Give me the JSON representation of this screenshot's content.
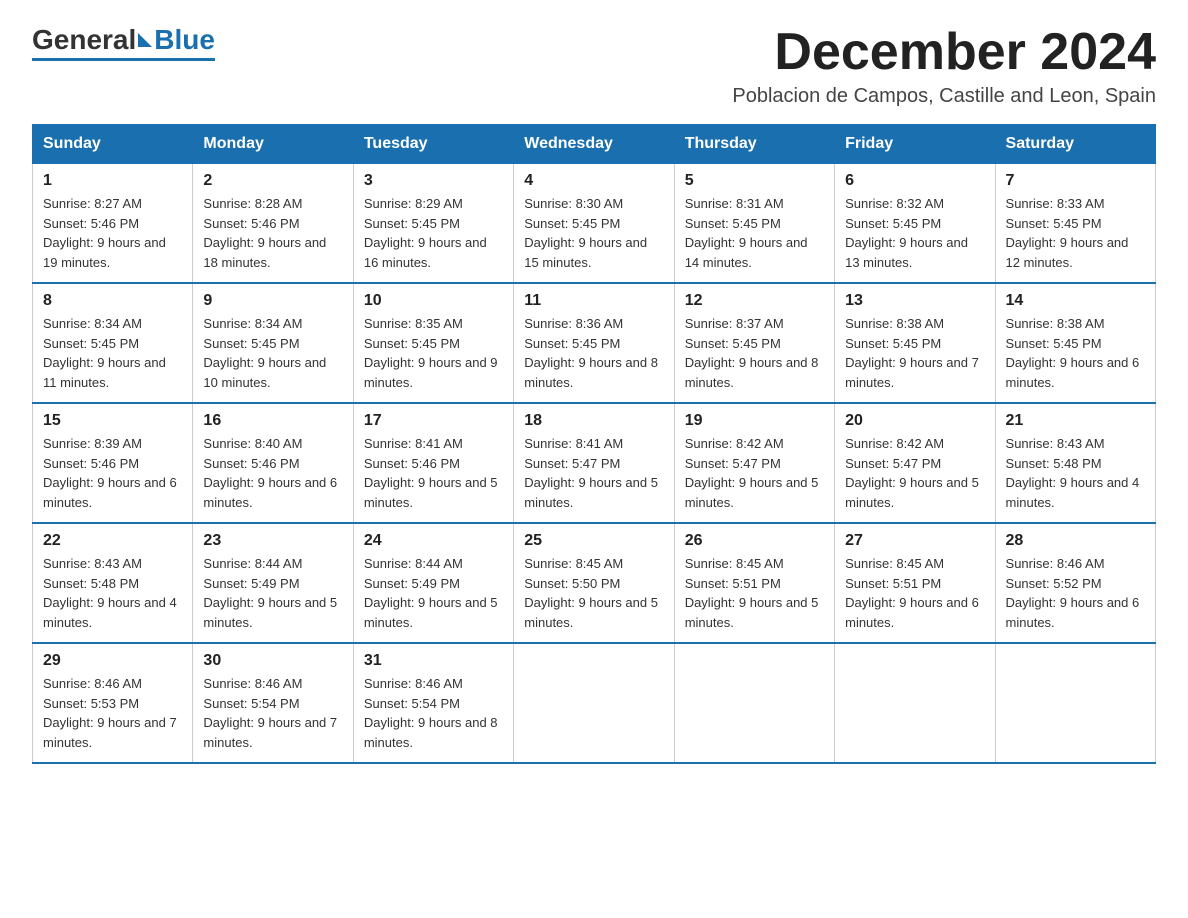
{
  "logo": {
    "general": "General",
    "blue": "Blue"
  },
  "header": {
    "month_title": "December 2024",
    "subtitle": "Poblacion de Campos, Castille and Leon, Spain"
  },
  "days_of_week": [
    "Sunday",
    "Monday",
    "Tuesday",
    "Wednesday",
    "Thursday",
    "Friday",
    "Saturday"
  ],
  "weeks": [
    [
      {
        "day": "1",
        "sunrise": "8:27 AM",
        "sunset": "5:46 PM",
        "daylight": "9 hours and 19 minutes."
      },
      {
        "day": "2",
        "sunrise": "8:28 AM",
        "sunset": "5:46 PM",
        "daylight": "9 hours and 18 minutes."
      },
      {
        "day": "3",
        "sunrise": "8:29 AM",
        "sunset": "5:45 PM",
        "daylight": "9 hours and 16 minutes."
      },
      {
        "day": "4",
        "sunrise": "8:30 AM",
        "sunset": "5:45 PM",
        "daylight": "9 hours and 15 minutes."
      },
      {
        "day": "5",
        "sunrise": "8:31 AM",
        "sunset": "5:45 PM",
        "daylight": "9 hours and 14 minutes."
      },
      {
        "day": "6",
        "sunrise": "8:32 AM",
        "sunset": "5:45 PM",
        "daylight": "9 hours and 13 minutes."
      },
      {
        "day": "7",
        "sunrise": "8:33 AM",
        "sunset": "5:45 PM",
        "daylight": "9 hours and 12 minutes."
      }
    ],
    [
      {
        "day": "8",
        "sunrise": "8:34 AM",
        "sunset": "5:45 PM",
        "daylight": "9 hours and 11 minutes."
      },
      {
        "day": "9",
        "sunrise": "8:34 AM",
        "sunset": "5:45 PM",
        "daylight": "9 hours and 10 minutes."
      },
      {
        "day": "10",
        "sunrise": "8:35 AM",
        "sunset": "5:45 PM",
        "daylight": "9 hours and 9 minutes."
      },
      {
        "day": "11",
        "sunrise": "8:36 AM",
        "sunset": "5:45 PM",
        "daylight": "9 hours and 8 minutes."
      },
      {
        "day": "12",
        "sunrise": "8:37 AM",
        "sunset": "5:45 PM",
        "daylight": "9 hours and 8 minutes."
      },
      {
        "day": "13",
        "sunrise": "8:38 AM",
        "sunset": "5:45 PM",
        "daylight": "9 hours and 7 minutes."
      },
      {
        "day": "14",
        "sunrise": "8:38 AM",
        "sunset": "5:45 PM",
        "daylight": "9 hours and 6 minutes."
      }
    ],
    [
      {
        "day": "15",
        "sunrise": "8:39 AM",
        "sunset": "5:46 PM",
        "daylight": "9 hours and 6 minutes."
      },
      {
        "day": "16",
        "sunrise": "8:40 AM",
        "sunset": "5:46 PM",
        "daylight": "9 hours and 6 minutes."
      },
      {
        "day": "17",
        "sunrise": "8:41 AM",
        "sunset": "5:46 PM",
        "daylight": "9 hours and 5 minutes."
      },
      {
        "day": "18",
        "sunrise": "8:41 AM",
        "sunset": "5:47 PM",
        "daylight": "9 hours and 5 minutes."
      },
      {
        "day": "19",
        "sunrise": "8:42 AM",
        "sunset": "5:47 PM",
        "daylight": "9 hours and 5 minutes."
      },
      {
        "day": "20",
        "sunrise": "8:42 AM",
        "sunset": "5:47 PM",
        "daylight": "9 hours and 5 minutes."
      },
      {
        "day": "21",
        "sunrise": "8:43 AM",
        "sunset": "5:48 PM",
        "daylight": "9 hours and 4 minutes."
      }
    ],
    [
      {
        "day": "22",
        "sunrise": "8:43 AM",
        "sunset": "5:48 PM",
        "daylight": "9 hours and 4 minutes."
      },
      {
        "day": "23",
        "sunrise": "8:44 AM",
        "sunset": "5:49 PM",
        "daylight": "9 hours and 5 minutes."
      },
      {
        "day": "24",
        "sunrise": "8:44 AM",
        "sunset": "5:49 PM",
        "daylight": "9 hours and 5 minutes."
      },
      {
        "day": "25",
        "sunrise": "8:45 AM",
        "sunset": "5:50 PM",
        "daylight": "9 hours and 5 minutes."
      },
      {
        "day": "26",
        "sunrise": "8:45 AM",
        "sunset": "5:51 PM",
        "daylight": "9 hours and 5 minutes."
      },
      {
        "day": "27",
        "sunrise": "8:45 AM",
        "sunset": "5:51 PM",
        "daylight": "9 hours and 6 minutes."
      },
      {
        "day": "28",
        "sunrise": "8:46 AM",
        "sunset": "5:52 PM",
        "daylight": "9 hours and 6 minutes."
      }
    ],
    [
      {
        "day": "29",
        "sunrise": "8:46 AM",
        "sunset": "5:53 PM",
        "daylight": "9 hours and 7 minutes."
      },
      {
        "day": "30",
        "sunrise": "8:46 AM",
        "sunset": "5:54 PM",
        "daylight": "9 hours and 7 minutes."
      },
      {
        "day": "31",
        "sunrise": "8:46 AM",
        "sunset": "5:54 PM",
        "daylight": "9 hours and 8 minutes."
      },
      null,
      null,
      null,
      null
    ]
  ]
}
